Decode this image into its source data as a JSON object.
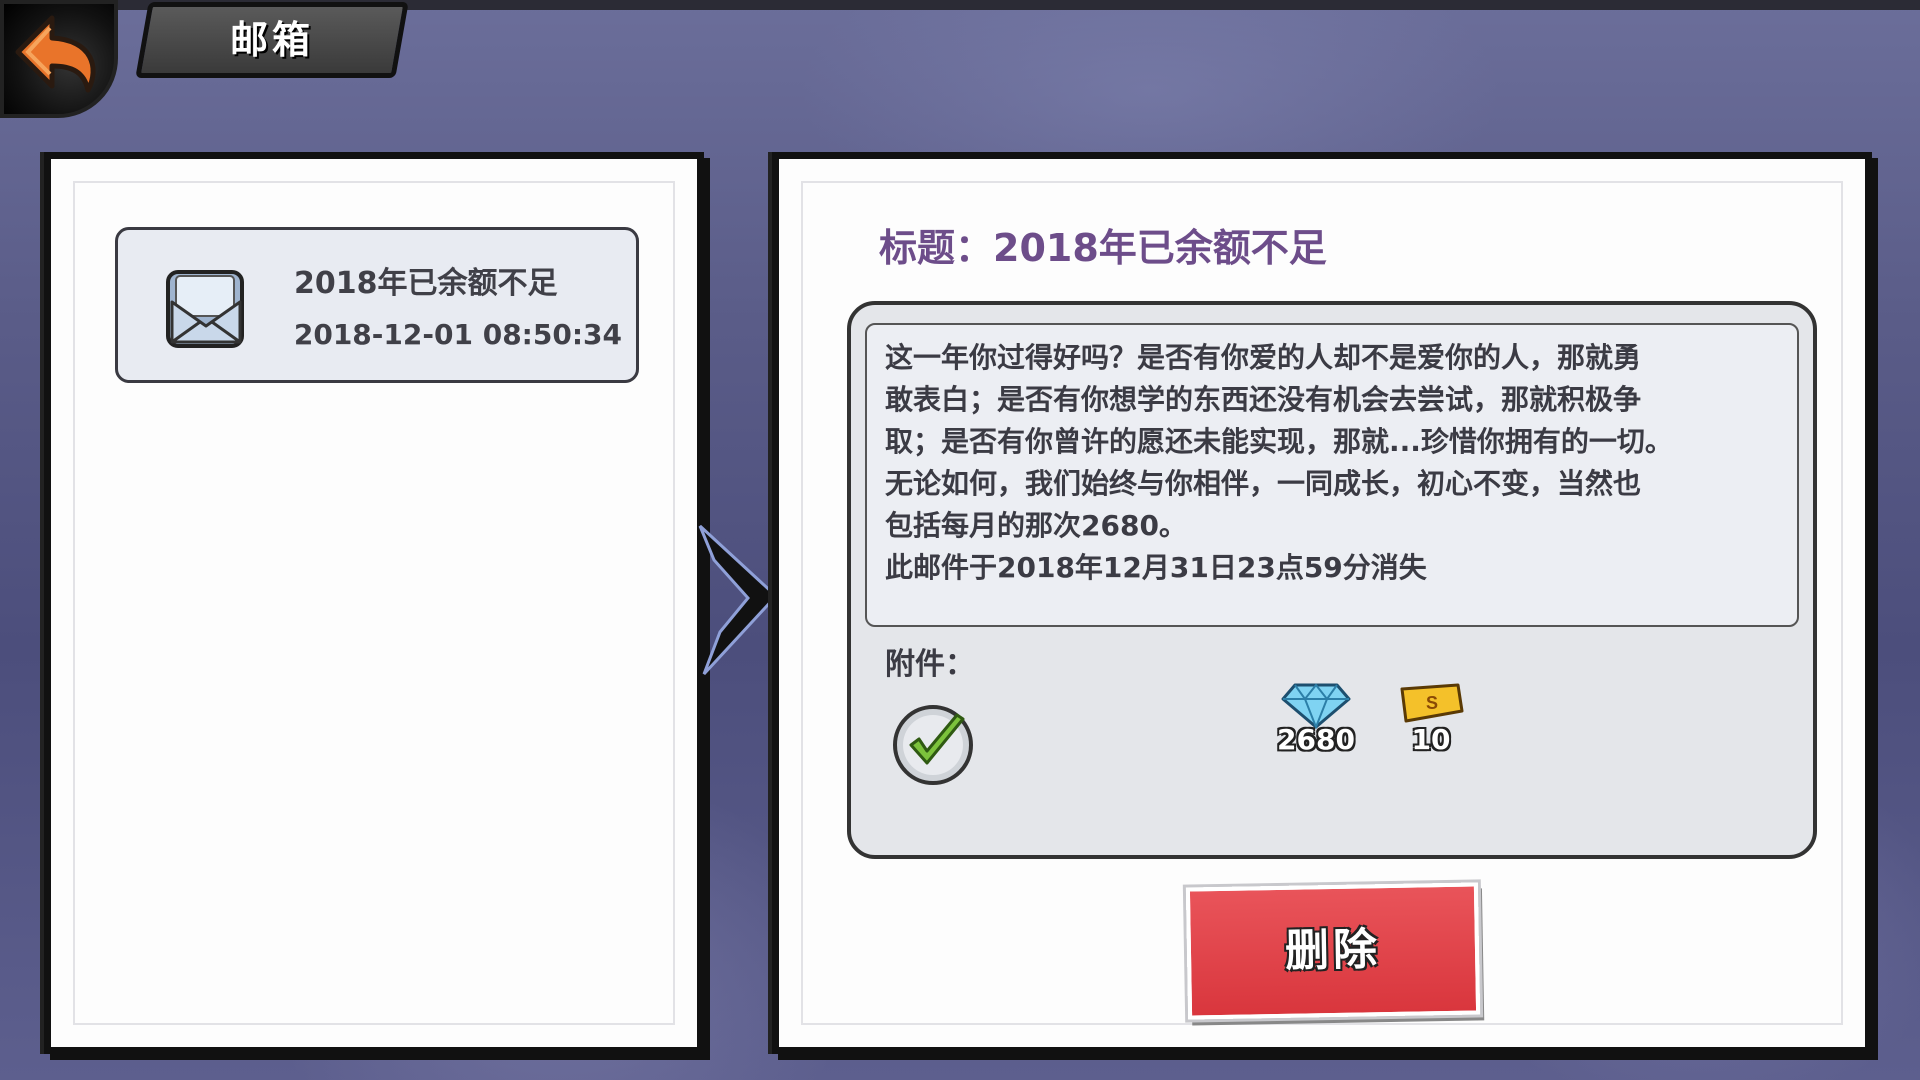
{
  "header": {
    "back_icon": "back-arrow-icon",
    "title": "邮箱"
  },
  "mail_list": {
    "items": [
      {
        "icon": "envelope-icon",
        "subject": "2018年已余额不足",
        "date": "2018-12-01 08:50:34"
      }
    ]
  },
  "detail": {
    "title": "标题：2018年已余额不足",
    "body": "这一年你过得好吗？是否有你爱的人却不是爱你的人，那就勇\n敢表白；是否有你想学的东西还没有机会去尝试，那就积极争\n取；是否有你曾许的愿还未能实现，那就...珍惜你拥有的一切。\n无论如何，我们始终与你相伴，一同成长，初心不变，当然也\n包括每月的那次2680。\n此邮件于2018年12月31日23点59分消失",
    "attachment_label": "附件：",
    "claimed_icon": "checkmark-icon",
    "attachments": [
      {
        "icon": "diamond-icon",
        "count": "2680"
      },
      {
        "icon": "gold-ticket-icon",
        "count": "10"
      }
    ],
    "delete_label": "删除"
  },
  "colors": {
    "title_purple": "#6d4d8a",
    "delete_red": "#d9363d",
    "background": "#5a5c88"
  }
}
